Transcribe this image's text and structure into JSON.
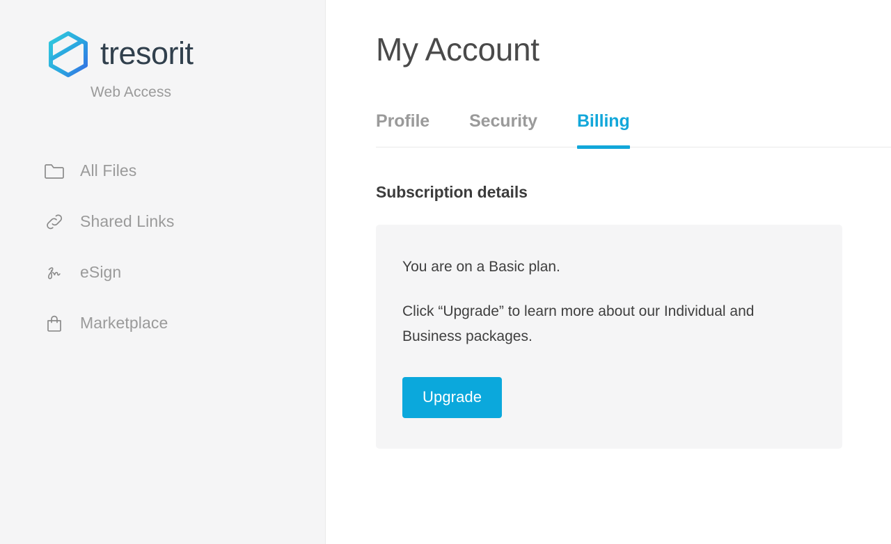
{
  "brand": {
    "name": "tresorit",
    "subtitle": "Web Access",
    "logo_icon": "hexagon-logo-icon",
    "logo_gradient_start": "#2bbbe0",
    "logo_gradient_end": "#2f7fe0"
  },
  "sidebar": {
    "items": [
      {
        "label": "All Files",
        "icon": "folder-icon"
      },
      {
        "label": "Shared Links",
        "icon": "link-chain-icon"
      },
      {
        "label": "eSign",
        "icon": "signature-icon"
      },
      {
        "label": "Marketplace",
        "icon": "shopping-bag-icon"
      }
    ]
  },
  "main": {
    "page_title": "My Account",
    "tabs": [
      {
        "label": "Profile",
        "active": false
      },
      {
        "label": "Security",
        "active": false
      },
      {
        "label": "Billing",
        "active": true
      }
    ],
    "section_title": "Subscription details",
    "card": {
      "plan_line": "You are on a Basic plan.",
      "description": "Click “Upgrade” to learn more about our Individual and Business packages.",
      "upgrade_label": "Upgrade"
    }
  },
  "colors": {
    "accent": "#0ba8dc",
    "tab_active": "#12a7da",
    "sidebar_bg": "#f5f5f6",
    "card_bg": "#f5f5f6",
    "muted_text": "#9a9a9a",
    "body_text": "#3f3f3f"
  }
}
